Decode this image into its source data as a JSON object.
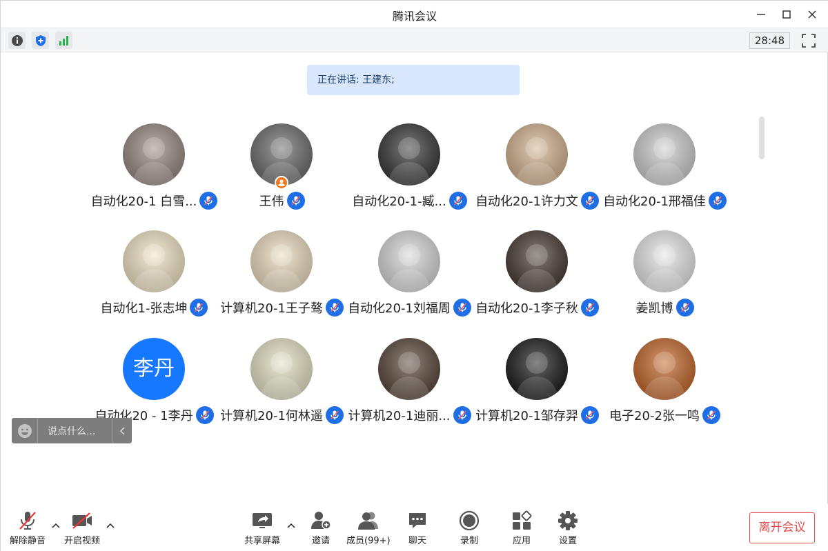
{
  "window": {
    "title": "腾讯会议"
  },
  "status_bar": {
    "timer": "28:48"
  },
  "speaking": {
    "label": "正在讲话: ",
    "name": "王建东;"
  },
  "participants": [
    {
      "name": "自动化20-1 白雪...",
      "avatar_color": "#9a8c86",
      "avatar_text": ""
    },
    {
      "name": "王伟",
      "avatar_color": "#6f6f6f",
      "avatar_text": "",
      "host": true
    },
    {
      "name": "自动化20-1-臧...",
      "avatar_color": "#3b3b3b",
      "avatar_text": ""
    },
    {
      "name": "自动化20-1许力文",
      "avatar_color": "#d5b592",
      "avatar_text": ""
    },
    {
      "name": "自动化20-1邢福佳",
      "avatar_color": "#cfcfcf",
      "avatar_text": ""
    },
    {
      "name": "自动化1-张志坤",
      "avatar_color": "#f3e6c8",
      "avatar_text": ""
    },
    {
      "name": "计算机20-1王子骜",
      "avatar_color": "#eedfc2",
      "avatar_text": ""
    },
    {
      "name": "自动化20-1刘福周",
      "avatar_color": "#d9d9d9",
      "avatar_text": ""
    },
    {
      "name": "自动化20-1李子秋",
      "avatar_color": "#4a3e36",
      "avatar_text": ""
    },
    {
      "name": "姜凯博",
      "avatar_color": "#e8e8e8",
      "avatar_text": ""
    },
    {
      "name": "自动化20 - 1李丹",
      "avatar_color": "#1677ff",
      "avatar_text": "李丹"
    },
    {
      "name": "计算机20-1何林遥",
      "avatar_color": "#e7e4c7",
      "avatar_text": ""
    },
    {
      "name": "计算机20-1迪丽...",
      "avatar_color": "#5c4a3e",
      "avatar_text": ""
    },
    {
      "name": "计算机20-1邹存羿",
      "avatar_color": "#1e1e1e",
      "avatar_text": ""
    },
    {
      "name": "电子20-2张一鸣",
      "avatar_color": "#c66a2e",
      "avatar_text": ""
    }
  ],
  "chat": {
    "placeholder": "说点什么..."
  },
  "toolbar": {
    "unmute": "解除静音",
    "video": "开启视频",
    "share": "共享屏幕",
    "invite": "邀请",
    "members": "成员(99+)",
    "chat": "聊天",
    "record": "录制",
    "apps": "应用",
    "settings": "设置",
    "leave": "离开会议"
  },
  "colors": {
    "accent": "#1e6ee6",
    "leave": "#e24a4a",
    "speaking_bg": "#d8e7fb"
  }
}
